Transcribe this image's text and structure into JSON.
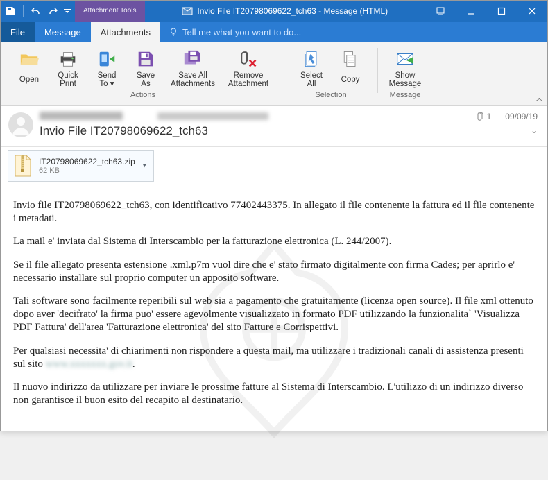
{
  "window": {
    "tools_tab_top": "Attachment Tools",
    "title_text": "Invio File  IT20798069622_tch63 - Message (HTML)"
  },
  "tabs": {
    "file": "File",
    "message": "Message",
    "attachments": "Attachments",
    "tell_me": "Tell me what you want to do..."
  },
  "ribbon": {
    "open": "Open",
    "quick_print": "Quick\nPrint",
    "send_to": "Send\nTo ▾",
    "save_as": "Save\nAs",
    "save_all": "Save All\nAttachments",
    "remove": "Remove\nAttachment",
    "select_all": "Select\nAll",
    "copy": "Copy",
    "show_message": "Show\nMessage",
    "group_actions": "Actions",
    "group_selection": "Selection",
    "group_message": "Message"
  },
  "header": {
    "subject": "Invio File  IT20798069622_tch63",
    "date": "09/09/19",
    "attachment_count": "1"
  },
  "attachment": {
    "name": "IT20798069622_tch63.zip",
    "size": "62 KB"
  },
  "body": {
    "p1": "Invio file IT20798069622_tch63, con identificativo 77402443375. In allegato il file contenente la fattura ed il file contenente i metadati.",
    "p2": "La mail e' inviata dal Sistema di Interscambio per la fatturazione elettronica (L. 244/2007).",
    "p3": "Se il file allegato presenta estensione .xml.p7m vuol dire che e' stato firmato digitalmente con firma Cades; per aprirlo e' necessario installare sul proprio computer un apposito software.",
    "p4": "Tali software sono facilmente reperibili sul web sia a pagamento che gratuitamente (licenza open source). Il file xml ottenuto dopo aver 'decifrato' la firma puo' essere agevolmente visualizzato in formato PDF utilizzando la funzionalita` 'Visualizza PDF Fattura' dell'area 'Fatturazione elettronica' del sito Fatture e Corrispettivi.",
    "p5a": "Per qualsiasi necessita' di chiarimenti non rispondere a questa mail, ma utilizzare i tradizionali canali di assistenza presenti sul sito ",
    "p5b_blur": "www.xxxxxxx.gov.it",
    "p5c": ".",
    "p6": "Il nuovo indirizzo da utilizzare per inviare le prossime fatture al Sistema di Interscambio. L'utilizzo di un indirizzo diverso non garantisce il buon esito del recapito al destinatario."
  },
  "colors": {
    "title_blue": "#1f6fc1",
    "tab_blue": "#2b7cd3",
    "purple": "#6c52a1",
    "ribbon_bg": "#f3f3f3"
  }
}
